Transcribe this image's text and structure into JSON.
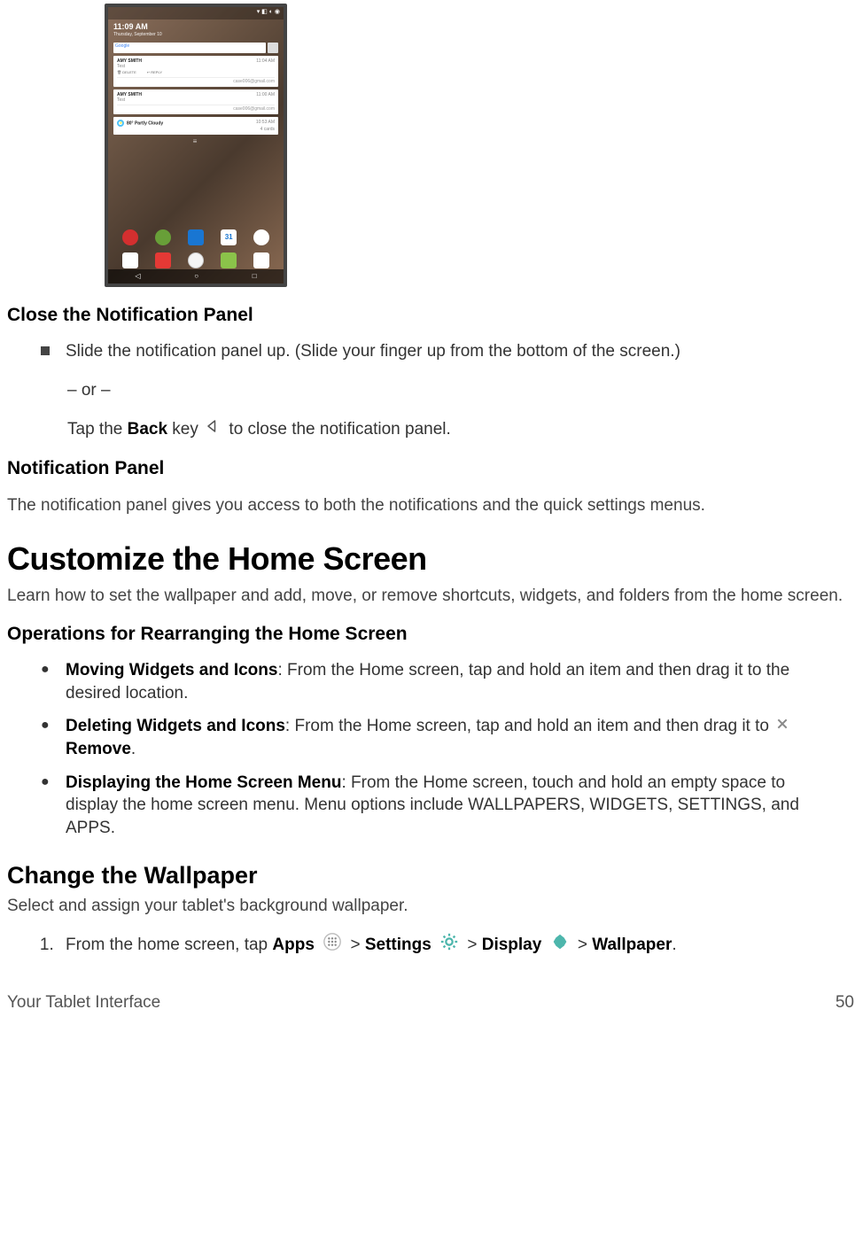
{
  "screenshot": {
    "status_icons": "▾ ◧ ◐ ◉",
    "time": "11:09 AM",
    "date": "Thursday, September 10",
    "search_brand": "Google",
    "notif1": {
      "name": "AMY SMITH",
      "sub": "Test",
      "time": "11:04 AM",
      "delete": "🗑 DELETE",
      "reply": "↩ REPLY",
      "acc": "case006@gmail.com"
    },
    "notif2": {
      "name": "AMY SMITH",
      "sub": "Test",
      "time": "11:00 AM",
      "acc": "case006@gmail.com"
    },
    "weather": {
      "text": "80° Partly Cloudy",
      "time": "10:53 AM",
      "sub": "4 cards"
    },
    "apprail": [
      "Gmail",
      "Hangouts",
      "Calendar",
      "31",
      "Camera"
    ],
    "dock": [
      "Google",
      "YouTube",
      "Apps",
      "Play",
      "Duo"
    ],
    "nav": {
      "back": "◁",
      "home": "○",
      "recent": "□"
    }
  },
  "s1_title": "Close the Notification Panel",
  "s1_b1": "Slide the notification panel up. (Slide your finger up from the bottom of the screen.)",
  "s1_or": "– or –",
  "s1_b2a": "Tap the ",
  "s1_b2b": "Back",
  "s1_b2c": " key ",
  "s1_b2d": " to close the notification panel.",
  "s2_title": "Notification Panel",
  "s2_p": "The notification panel gives you access to both the notifications and the quick settings menus.",
  "h1": "Customize the Home Screen",
  "h1_p": "Learn how to set the wallpaper and add, move, or remove shortcuts, widgets, and folders from the home screen.",
  "s3_title": "Operations for Rearranging the Home Screen",
  "op1_b": "Moving Widgets and Icons",
  "op1_t": ": From the Home screen, tap and hold an item and then drag it to the desired location.",
  "op2_b": "Deleting Widgets and Icons",
  "op2_t1": ": From the Home screen, tap and hold an item and then drag it to ",
  "op2_t2": " Remove",
  "op2_t3": ".",
  "op3_b": "Displaying the Home Screen Menu",
  "op3_t": ": From the Home screen, touch and hold an empty space to display the home screen menu. Menu options include WALLPAPERS, WIDGETS, SETTINGS, and APPS.",
  "h2": "Change the Wallpaper",
  "h2_p": "Select and assign your tablet's background wallpaper.",
  "step1_a": "From the home screen, tap ",
  "step1_apps": "Apps",
  "step1_gt1": " > ",
  "step1_settings": "Settings",
  "step1_gt2": " > ",
  "step1_display": "Display",
  "step1_gt3": " > ",
  "step1_wallpaper": "Wallpaper",
  "step1_end": ".",
  "footer_left": "Your Tablet Interface",
  "footer_right": "50"
}
